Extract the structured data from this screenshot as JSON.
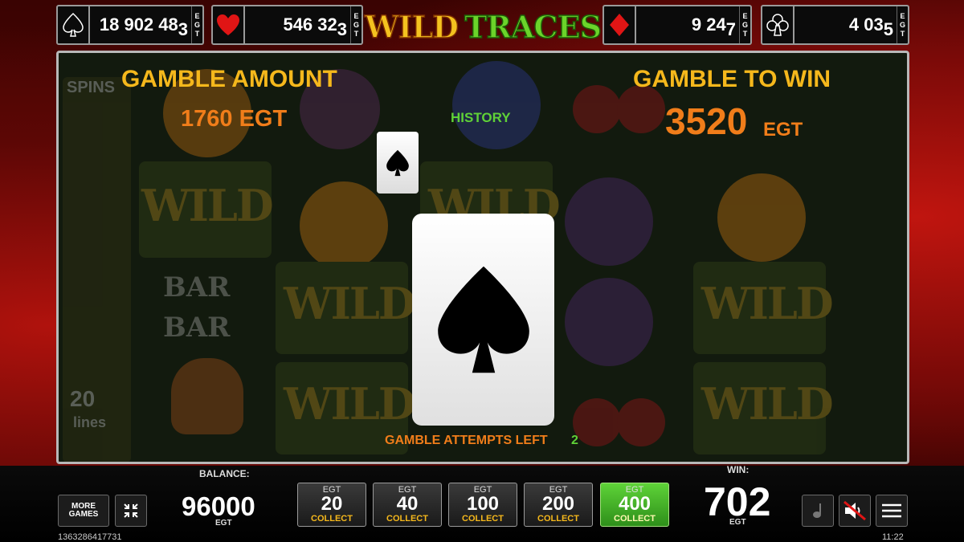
{
  "game": {
    "logo_part1": "WILD",
    "logo_part2": "TRACES"
  },
  "jackpots": [
    {
      "suit": "spade-icon",
      "value_main": "18 902 48",
      "value_last": "3",
      "unit_letters": [
        "E",
        "G",
        "T"
      ]
    },
    {
      "suit": "heart-icon",
      "value_main": "546 32",
      "value_last": "3",
      "unit_letters": [
        "E",
        "G",
        "T"
      ]
    },
    {
      "suit": "diamond-icon",
      "value_main": "9 24",
      "value_last": "7",
      "unit_letters": [
        "E",
        "G",
        "T"
      ]
    },
    {
      "suit": "club-icon",
      "value_main": "4 03",
      "value_last": "5",
      "unit_letters": [
        "E",
        "G",
        "T"
      ]
    }
  ],
  "gamble": {
    "amount_label": "GAMBLE AMOUNT",
    "amount_value": "1760 EGT",
    "history_label": "HISTORY",
    "history_cards": [
      "spade-icon"
    ],
    "to_win_label": "GAMBLE TO WIN",
    "to_win_value": "3520",
    "to_win_unit": "EGT",
    "current_card": "spade-icon",
    "attempts_label": "GAMBLE ATTEMPTS LEFT",
    "attempts_value": "2"
  },
  "reels_background": {
    "symbols": [
      "WILD",
      "BAR",
      "BAR",
      "SPINS",
      "20",
      "lines"
    ]
  },
  "bottom": {
    "more_games_label_1": "MORE",
    "more_games_label_2": "GAMES",
    "balance_label": "BALANCE:",
    "balance_value": "96000",
    "balance_unit": "EGT",
    "bets": [
      {
        "top": "EGT",
        "value": "20",
        "label": "COLLECT",
        "active": false
      },
      {
        "top": "EGT",
        "value": "40",
        "label": "COLLECT",
        "active": false
      },
      {
        "top": "EGT",
        "value": "100",
        "label": "COLLECT",
        "active": false
      },
      {
        "top": "EGT",
        "value": "200",
        "label": "COLLECT",
        "active": false
      },
      {
        "top": "EGT",
        "value": "400",
        "label": "COLLECT",
        "active": true
      }
    ],
    "win_label": "WIN:",
    "win_value": "702",
    "win_unit": "EGT",
    "ticket_id": "1363286417731",
    "clock": "11:22"
  },
  "colors": {
    "label_gold": "#f5b81c",
    "value_orange": "#f07d1a",
    "history_green": "#5fd137",
    "active_bet_green": "#4cc02c"
  }
}
